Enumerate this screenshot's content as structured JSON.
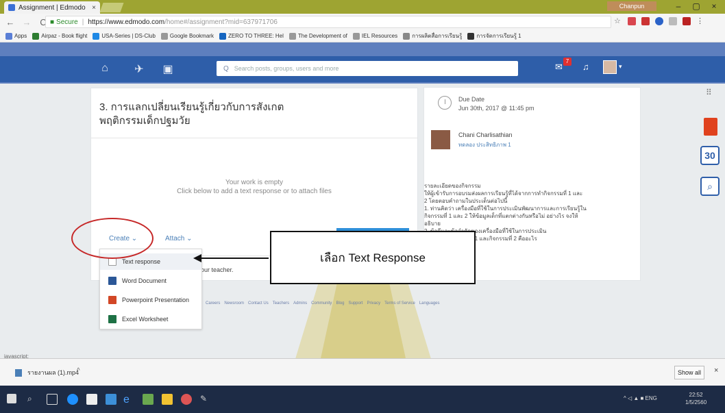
{
  "browser": {
    "tab_title": "Assignment | Edmodo",
    "tab_close": "×",
    "profile": "Chanpun",
    "win_min": "–",
    "win_max": "▢",
    "win_close": "×",
    "secure_label": "Secure",
    "url_host": "https://www.edmodo.com",
    "url_path": "/home#/assignment?mid=637971706"
  },
  "bookmarks": [
    {
      "label": "Apps",
      "color": "#5a7fd6"
    },
    {
      "label": "Airpaz - Book flight",
      "color": "#2e7d32"
    },
    {
      "label": "USA-Series | DS-Club",
      "color": "#1e88e5"
    },
    {
      "label": "Google Bookmark",
      "color": "#999999"
    },
    {
      "label": "ZERO TO THREE: Hel",
      "color": "#1565c0"
    },
    {
      "label": "The Development of",
      "color": "#999999"
    },
    {
      "label": "IEL Resources",
      "color": "#999999"
    },
    {
      "label": "การผลิตสื่อการเรียนรู้",
      "color": "#888888"
    },
    {
      "label": "การจัดการเรียนรู้ 1",
      "color": "#333333"
    }
  ],
  "edmodo": {
    "search_placeholder": "Search posts, groups, users and more",
    "notif_count": "7"
  },
  "assignment": {
    "title": "3. การแลกเปลี่ยนเรียนรู้เกี่ยวกับการสังเกต พฤติกรรมเด็กปฐมวัย",
    "empty_line1": "Your work is empty",
    "empty_line2": "Click below to add a text response or to attach files",
    "create_label": "Create",
    "attach_label": "Attach",
    "teacher_note": "our teacher."
  },
  "dropdown": [
    {
      "label": "Text response",
      "icon": "text-icon",
      "color": "#ffffff"
    },
    {
      "label": "Word Document",
      "icon": "word-icon",
      "color": "#2b5797"
    },
    {
      "label": "Powerpoint Presentation",
      "icon": "powerpoint-icon",
      "color": "#d24726"
    },
    {
      "label": "Excel Worksheet",
      "icon": "excel-icon",
      "color": "#1e7145"
    }
  ],
  "details": {
    "due_label": "Due Date",
    "due_date": "Jun 30th, 2017 @ 11:45 pm",
    "author": "Chani Charlisathian",
    "group": "ทดลอง ประสิทธิภาพ 1",
    "desc_lines": [
      "รายละเอียดของกิจกรรม",
      "ให้ผู้เข้ารับการอบรมส่งผลการเรียนรู้ที่ได้จากการทำกิจกรรมที่ 1 และ",
      "2 โดยตอบคำถามในประเด็นต่อไปนี้",
      "1. ท่านคิดว่า เครื่องมือที่ใช้ในการประเมินพัฒนาการและการเรียนรู้ใน",
      "กิจกรรมที่ 1 และ 2 ให้ข้อมูลเด็กที่แตกต่างกันหรือไม่ อย่างไร จงให้",
      "อธิบาย",
      "2. ข้อดีและข้อจำกัดของเครื่องมือที่ใช้ในการประเมิน",
      "ผู้ปฐมวัยในกิจกรรมที่ 1 และกิจกรรมที่ 2 คืออะไร"
    ]
  },
  "footer_links": [
    "Careers",
    "Newsroom",
    "Contact Us",
    "Teachers",
    "Admins",
    "Community",
    "Blog",
    "Support",
    "Privacy",
    "Terms of Service",
    "Languages"
  ],
  "callout": "เลือก Text Response",
  "statusline": "javascript:",
  "download": {
    "file": "รายงานผล (1).mp4",
    "show_all": "Show all",
    "close": "×"
  },
  "taskbar": {
    "time": "22:52",
    "date": "1/5/2560",
    "lang": "ENG"
  }
}
